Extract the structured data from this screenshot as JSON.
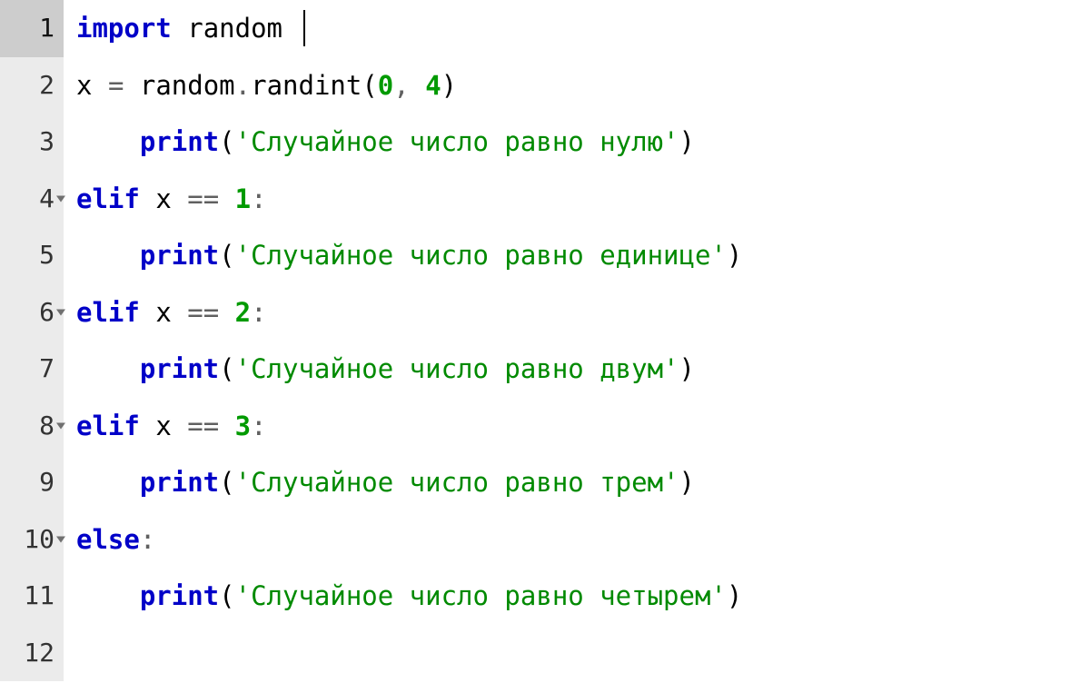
{
  "editor": {
    "active_line": 1,
    "lines": [
      {
        "num": "1",
        "fold": false,
        "indent": "",
        "tokens": [
          {
            "t": "import",
            "cls": "kw"
          },
          {
            "t": " ",
            "cls": ""
          },
          {
            "t": "random",
            "cls": "name"
          },
          {
            "t": " ",
            "cls": ""
          }
        ],
        "cursor_after": true
      },
      {
        "num": "2",
        "fold": false,
        "indent": "",
        "tokens": [
          {
            "t": "x",
            "cls": "name"
          },
          {
            "t": " ",
            "cls": ""
          },
          {
            "t": "=",
            "cls": "op"
          },
          {
            "t": " ",
            "cls": ""
          },
          {
            "t": "random",
            "cls": "name"
          },
          {
            "t": ".",
            "cls": "op"
          },
          {
            "t": "randint",
            "cls": "call"
          },
          {
            "t": "(",
            "cls": "punct"
          },
          {
            "t": "0",
            "cls": "num"
          },
          {
            "t": ",",
            "cls": "op"
          },
          {
            "t": " ",
            "cls": ""
          },
          {
            "t": "4",
            "cls": "num"
          },
          {
            "t": ")",
            "cls": "punct"
          }
        ]
      },
      {
        "num": "3",
        "fold": false,
        "indent": "    ",
        "tokens": [
          {
            "t": "print",
            "cls": "kw"
          },
          {
            "t": "(",
            "cls": "punct"
          },
          {
            "t": "'Случайное число равно нулю'",
            "cls": "str"
          },
          {
            "t": ")",
            "cls": "punct"
          }
        ]
      },
      {
        "num": "4",
        "fold": true,
        "indent": "",
        "tokens": [
          {
            "t": "elif",
            "cls": "kw"
          },
          {
            "t": " ",
            "cls": ""
          },
          {
            "t": "x",
            "cls": "name"
          },
          {
            "t": " ",
            "cls": ""
          },
          {
            "t": "==",
            "cls": "op"
          },
          {
            "t": " ",
            "cls": ""
          },
          {
            "t": "1",
            "cls": "num"
          },
          {
            "t": ":",
            "cls": "op"
          }
        ]
      },
      {
        "num": "5",
        "fold": false,
        "indent": "    ",
        "tokens": [
          {
            "t": "print",
            "cls": "kw"
          },
          {
            "t": "(",
            "cls": "punct"
          },
          {
            "t": "'Случайное число равно единице'",
            "cls": "str"
          },
          {
            "t": ")",
            "cls": "punct"
          }
        ]
      },
      {
        "num": "6",
        "fold": true,
        "indent": "",
        "tokens": [
          {
            "t": "elif",
            "cls": "kw"
          },
          {
            "t": " ",
            "cls": ""
          },
          {
            "t": "x",
            "cls": "name"
          },
          {
            "t": " ",
            "cls": ""
          },
          {
            "t": "==",
            "cls": "op"
          },
          {
            "t": " ",
            "cls": ""
          },
          {
            "t": "2",
            "cls": "num"
          },
          {
            "t": ":",
            "cls": "op"
          }
        ]
      },
      {
        "num": "7",
        "fold": false,
        "indent": "    ",
        "tokens": [
          {
            "t": "print",
            "cls": "kw"
          },
          {
            "t": "(",
            "cls": "punct"
          },
          {
            "t": "'Случайное число равно двум'",
            "cls": "str"
          },
          {
            "t": ")",
            "cls": "punct"
          }
        ]
      },
      {
        "num": "8",
        "fold": true,
        "indent": "",
        "tokens": [
          {
            "t": "elif",
            "cls": "kw"
          },
          {
            "t": " ",
            "cls": ""
          },
          {
            "t": "x",
            "cls": "name"
          },
          {
            "t": " ",
            "cls": ""
          },
          {
            "t": "==",
            "cls": "op"
          },
          {
            "t": " ",
            "cls": ""
          },
          {
            "t": "3",
            "cls": "num"
          },
          {
            "t": ":",
            "cls": "op"
          }
        ]
      },
      {
        "num": "9",
        "fold": false,
        "indent": "    ",
        "tokens": [
          {
            "t": "print",
            "cls": "kw"
          },
          {
            "t": "(",
            "cls": "punct"
          },
          {
            "t": "'Случайное число равно трем'",
            "cls": "str"
          },
          {
            "t": ")",
            "cls": "punct"
          }
        ]
      },
      {
        "num": "10",
        "fold": true,
        "indent": "",
        "tokens": [
          {
            "t": "else",
            "cls": "kw"
          },
          {
            "t": ":",
            "cls": "op"
          }
        ]
      },
      {
        "num": "11",
        "fold": false,
        "indent": "    ",
        "tokens": [
          {
            "t": "print",
            "cls": "kw"
          },
          {
            "t": "(",
            "cls": "punct"
          },
          {
            "t": "'Случайное число равно четырем'",
            "cls": "str"
          },
          {
            "t": ")",
            "cls": "punct"
          }
        ]
      },
      {
        "num": "12",
        "fold": false,
        "indent": "",
        "tokens": []
      }
    ]
  }
}
